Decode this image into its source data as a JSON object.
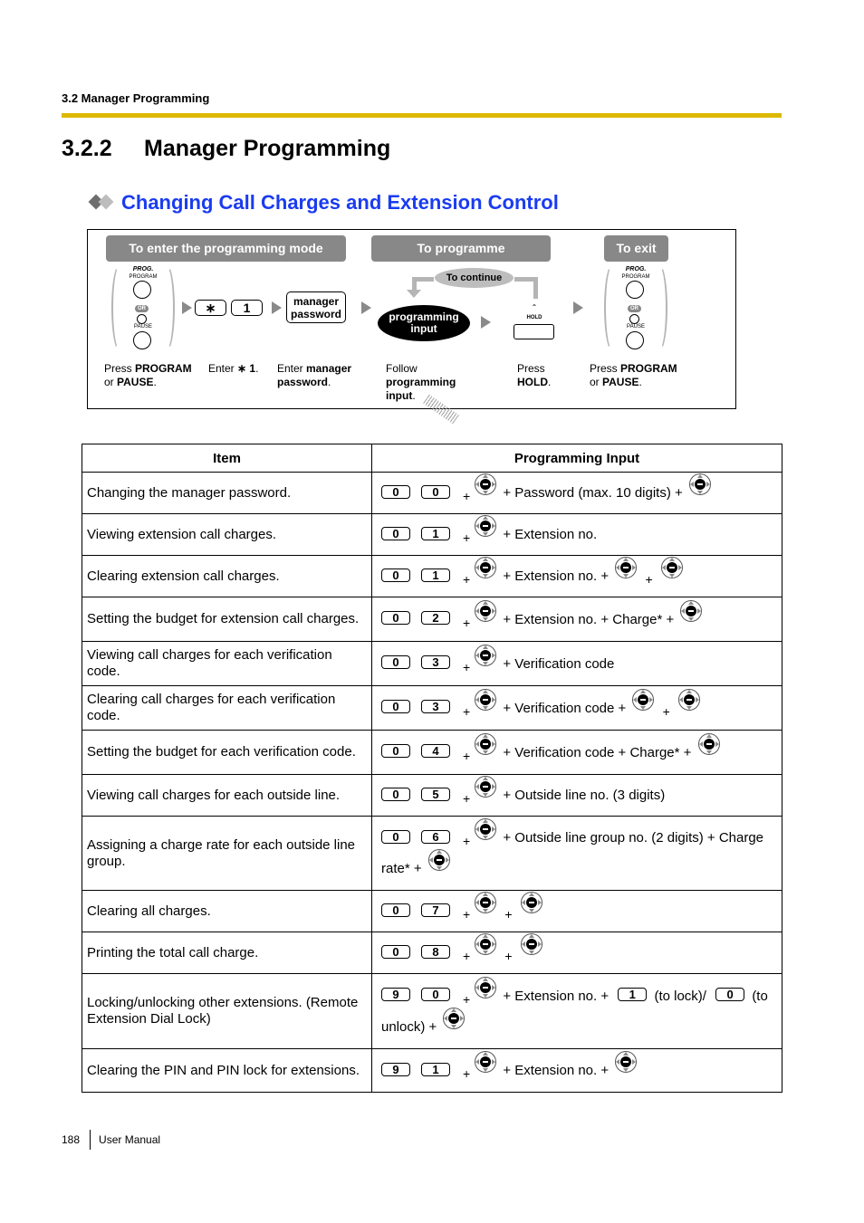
{
  "running_head": "3.2 Manager Programming",
  "section": {
    "number": "3.2.2",
    "title": "Manager Programming"
  },
  "subheading": "Changing Call Charges and Extension Control",
  "colors": {
    "accent_rule": "#dcb800",
    "subheading": "#1a3cf0",
    "pill": "#888888"
  },
  "flow": {
    "stage_enter": "To enter the programming mode",
    "stage_program": "To programme",
    "stage_exit": "To exit",
    "to_continue": "To continue",
    "phone_labels": {
      "prog": "PROG.",
      "program": "PROGRAM",
      "or": "OR",
      "pause": "PAUSE",
      "hold": "HOLD"
    },
    "keys": {
      "star": "∗",
      "one": "1"
    },
    "manager_box": [
      "manager",
      "password"
    ],
    "prog_input_oval": [
      "programming",
      "input"
    ],
    "captions": {
      "step1": {
        "pre": "Press ",
        "b1": "PROGRAM",
        "mid": "or ",
        "b2": "PAUSE",
        "post": "."
      },
      "step2": {
        "pre": "Enter ",
        "b1": "∗ 1",
        "post": "."
      },
      "step3": {
        "pre": "Enter ",
        "b1": "manager",
        "b2": "password",
        "post": "."
      },
      "step4": {
        "pre": "Follow",
        "b1": "programming",
        "b2": "input",
        "post": "."
      },
      "step5": {
        "pre": "Press",
        "b1": "HOLD",
        "post": "."
      },
      "step6": {
        "pre": "Press ",
        "b1": "PROGRAM",
        "mid": "or ",
        "b2": "PAUSE",
        "post": "."
      }
    }
  },
  "table": {
    "headers": {
      "item": "Item",
      "input": "Programming Input"
    },
    "rows": [
      {
        "item": "Changing the manager password.",
        "keys": [
          "0",
          "0"
        ],
        "seq": [
          {
            "t": "enter"
          },
          {
            "t": "text",
            "v": "+ Password (max. 10 digits) +"
          },
          {
            "t": "enter"
          }
        ]
      },
      {
        "item": "Viewing extension call charges.",
        "keys": [
          "0",
          "1"
        ],
        "seq": [
          {
            "t": "enter"
          },
          {
            "t": "text",
            "v": "+ Extension no."
          }
        ]
      },
      {
        "item": "Clearing extension call charges.",
        "keys": [
          "0",
          "1"
        ],
        "seq": [
          {
            "t": "enter"
          },
          {
            "t": "text",
            "v": "+ Extension no. +"
          },
          {
            "t": "enter"
          },
          {
            "t": "plus"
          },
          {
            "t": "enter"
          }
        ]
      },
      {
        "item": "Setting the budget for extension call charges.",
        "keys": [
          "0",
          "2"
        ],
        "seq": [
          {
            "t": "enter"
          },
          {
            "t": "text",
            "v": "+ Extension no. + Charge* +"
          },
          {
            "t": "enter"
          }
        ]
      },
      {
        "item": "Viewing call charges for each verification code.",
        "keys": [
          "0",
          "3"
        ],
        "seq": [
          {
            "t": "enter"
          },
          {
            "t": "text",
            "v": "+ Verification code"
          }
        ]
      },
      {
        "item": "Clearing call charges for each verification code.",
        "keys": [
          "0",
          "3"
        ],
        "seq": [
          {
            "t": "enter"
          },
          {
            "t": "text",
            "v": "+ Verification code +"
          },
          {
            "t": "enter"
          },
          {
            "t": "plus"
          },
          {
            "t": "enter"
          }
        ]
      },
      {
        "item": "Setting the budget for each verification code.",
        "keys": [
          "0",
          "4"
        ],
        "seq": [
          {
            "t": "enter"
          },
          {
            "t": "text",
            "v": "+ Verification code + Charge* +"
          },
          {
            "t": "enter"
          }
        ]
      },
      {
        "item": "Viewing call charges for each outside line.",
        "keys": [
          "0",
          "5"
        ],
        "seq": [
          {
            "t": "enter"
          },
          {
            "t": "text",
            "v": "+ Outside line no. (3 digits)"
          }
        ]
      },
      {
        "item": "Assigning a charge rate for each outside line group.",
        "keys": [
          "0",
          "6"
        ],
        "seq": [
          {
            "t": "enter"
          },
          {
            "t": "text",
            "v": "+ Outside line group no. (2 digits) + Charge rate* +"
          },
          {
            "t": "enter"
          }
        ]
      },
      {
        "item": "Clearing all charges.",
        "keys": [
          "0",
          "7"
        ],
        "seq": [
          {
            "t": "enter"
          },
          {
            "t": "plus"
          },
          {
            "t": "enter"
          }
        ]
      },
      {
        "item": "Printing the total call charge.",
        "keys": [
          "0",
          "8"
        ],
        "seq": [
          {
            "t": "enter"
          },
          {
            "t": "plus"
          },
          {
            "t": "enter"
          }
        ]
      },
      {
        "item": "Locking/unlocking other extensions. (Remote Extension Dial Lock)",
        "keys": [
          "9",
          "0"
        ],
        "seq": [
          {
            "t": "enter"
          },
          {
            "t": "text",
            "v": "+ Extension no. +"
          },
          {
            "t": "key",
            "v": "1"
          },
          {
            "t": "text",
            "v": "(to lock)/"
          },
          {
            "t": "key",
            "v": "0"
          },
          {
            "t": "text",
            "v": "(to unlock) +"
          },
          {
            "t": "enter"
          }
        ]
      },
      {
        "item": "Clearing the PIN and PIN lock for extensions.",
        "keys": [
          "9",
          "1"
        ],
        "seq": [
          {
            "t": "enter"
          },
          {
            "t": "text",
            "v": "+ Extension no. +"
          },
          {
            "t": "enter"
          }
        ]
      }
    ]
  },
  "footer": {
    "page": "188",
    "doc": "User Manual"
  }
}
